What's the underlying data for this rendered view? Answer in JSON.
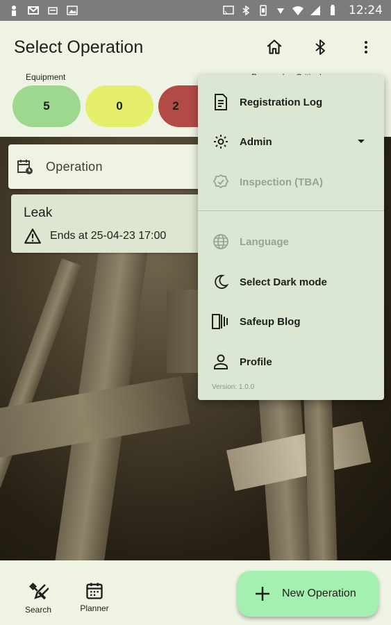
{
  "status_bar": {
    "time": "12:24",
    "left_icons": [
      "person-icon",
      "mail-icon",
      "card-icon",
      "picture-icon"
    ],
    "right_icons": [
      "cast-icon",
      "bluetooth-icon",
      "vibrate-icon",
      "wifi-icon",
      "signal-icon",
      "battery-icon"
    ]
  },
  "app_bar": {
    "title": "Select Operation",
    "actions": [
      "home-icon",
      "bluetooth-icon",
      "more-vert-icon"
    ]
  },
  "equipment": {
    "label": "Equipment",
    "pills": [
      {
        "value": "5",
        "color": "#9ed88f"
      },
      {
        "value": "0",
        "color": "#e6ef6a"
      },
      {
        "value": "2",
        "color": "#b24b45"
      }
    ]
  },
  "category_label": "Personal ... Critical ...",
  "operation_field": {
    "label": "Operation",
    "icon": "operation-calendar-icon"
  },
  "leak_card": {
    "title": "Leak",
    "ends_text": "Ends at 25-04-23 17:00",
    "icon": "warning-icon"
  },
  "menu": {
    "items": [
      {
        "label": "Registration Log",
        "icon": "description-icon",
        "enabled": true
      },
      {
        "label": "Admin",
        "icon": "gear-icon",
        "enabled": true,
        "has_dropdown": true
      },
      {
        "label": "Inspection (TBA)",
        "icon": "verified-icon",
        "enabled": false
      },
      {
        "label": "Language",
        "icon": "globe-icon",
        "enabled": false
      },
      {
        "label": "Select Dark mode",
        "icon": "moon-icon",
        "enabled": true
      },
      {
        "label": "Safeup Blog",
        "icon": "blog-icon",
        "enabled": true
      },
      {
        "label": "Profile",
        "icon": "person-icon",
        "enabled": true
      }
    ],
    "version": "Version: 1.0.0"
  },
  "bottom_nav": {
    "items": [
      {
        "label": "Search",
        "icon": "tools-icon"
      },
      {
        "label": "Planner",
        "icon": "calendar-icon"
      }
    ]
  },
  "fab": {
    "label": "New Operation",
    "icon": "plus-icon"
  },
  "colors": {
    "background": "#eef3e4",
    "menu_bg": "#dbe7d2",
    "fab_bg": "#a3f0b0",
    "status_bar": "#7c7c7c"
  }
}
